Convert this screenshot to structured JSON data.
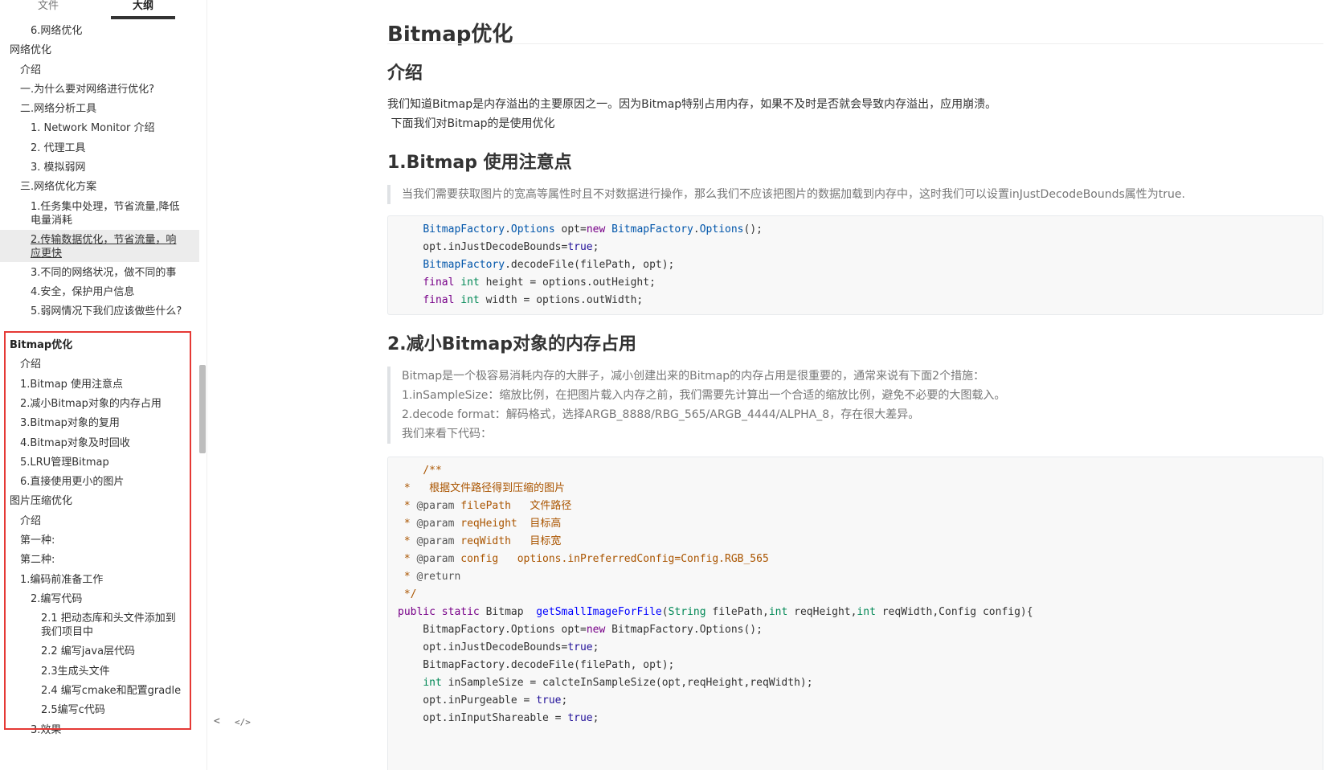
{
  "sidebar": {
    "tabs": [
      "文件",
      "大纲"
    ],
    "items": [
      {
        "label": "6.网络优化",
        "level": 3
      },
      {
        "label": "网络优化",
        "level": 1
      },
      {
        "label": "介绍",
        "level": 2
      },
      {
        "label": "一.为什么要对网络进行优化?",
        "level": 2
      },
      {
        "label": "二.网络分析工具",
        "level": 2
      },
      {
        "label": "1. Network Monitor 介绍",
        "level": 3
      },
      {
        "label": "2. 代理工具",
        "level": 3
      },
      {
        "label": "3. 模拟弱网",
        "level": 3
      },
      {
        "label": "三.网络优化方案",
        "level": 2
      },
      {
        "label": "1.任务集中处理，节省流量,降低电量消耗",
        "level": 3
      },
      {
        "label": "2.传输数据优化，节省流量，响应更快",
        "level": 3
      },
      {
        "label": "3.不同的网络状况，做不同的事",
        "level": 3
      },
      {
        "label": "4.安全，保护用户信息",
        "level": 3
      },
      {
        "label": "5.弱网情况下我们应该做些什么?",
        "level": 3
      },
      {
        "label": "Bitmap优化",
        "level": 1
      },
      {
        "label": "介绍",
        "level": 2
      },
      {
        "label": "1.Bitmap 使用注意点",
        "level": 2
      },
      {
        "label": "2.减小Bitmap对象的内存占用",
        "level": 2
      },
      {
        "label": "3.Bitmap对象的复用",
        "level": 2
      },
      {
        "label": "4.Bitmap对象及时回收",
        "level": 2
      },
      {
        "label": "5.LRU管理Bitmap",
        "level": 2
      },
      {
        "label": "6.直接使用更小的图片",
        "level": 2
      },
      {
        "label": "图片压缩优化",
        "level": 1
      },
      {
        "label": "介绍",
        "level": 2
      },
      {
        "label": "第一种:",
        "level": 2
      },
      {
        "label": "第二种:",
        "level": 2
      },
      {
        "label": "1.编码前准备工作",
        "level": 2
      },
      {
        "label": "2.编写代码",
        "level": 3
      },
      {
        "label": "2.1 把动态库和头文件添加到我们项目中",
        "level": 4
      },
      {
        "label": "2.2 编写java层代码",
        "level": 4
      },
      {
        "label": "2.3生成头文件",
        "level": 4
      },
      {
        "label": "2.4 编写cmake和配置gradle",
        "level": 4
      },
      {
        "label": "2.5编写c代码",
        "level": 4
      },
      {
        "label": "3.效果",
        "level": 3
      }
    ],
    "active_index": 10,
    "tools": [
      "<",
      "</>"
    ]
  },
  "main": {
    "title": "Bitmap优化",
    "intro_heading": "介绍",
    "intro_lines": [
      "我们知道Bitmap是内存溢出的主要原因之一。因为Bitmap特别占用内存，如果不及时是否就会导致内存溢出，应用崩溃。",
      " 下面我们对Bitmap的是使用优化"
    ],
    "section1_heading": "1.Bitmap 使用注意点",
    "section1_quote": "当我们需要获取图片的宽高等属性时且不对数据进行操作，那么我们不应该把图片的数据加载到内存中，这时我们可以设置inJustDecodeBounds属性为true.",
    "section2_heading": "2.减小Bitmap对象的内存占用",
    "section2_quote": [
      "Bitmap是一个极容易消耗内存的大胖子，减小创建出来的Bitmap的内存占用是很重要的，通常来说有下面2个措施：",
      "1.inSampleSize：缩放比例，在把图片载入内存之前，我们需要先计算出一个合适的缩放比例，避免不必要的大图载入。",
      "2.decode format：解码格式，选择ARGB_8888/RBG_565/ARGB_4444/ALPHA_8，存在很大差异。",
      "我们来看下代码："
    ]
  },
  "code1": [
    "    BitmapFactory.Options opt=new BitmapFactory.Options();",
    "    opt.inJustDecodeBounds=true;",
    "    BitmapFactory.decodeFile(filePath, opt);",
    "    final int height = options.outHeight;",
    "    final int width = options.outWidth;"
  ],
  "code2": [
    "    /**",
    " *   根据文件路径得到压缩的图片",
    " * @param filePath   文件路径",
    " * @param reqHeight  目标高",
    " * @param reqWidth   目标宽",
    " * @param config   options.inPreferredConfig=Config.RGB_565",
    " * @return",
    " */",
    "public static Bitmap  getSmallImageForFile(String filePath,int reqHeight,int reqWidth,Config config){",
    "    BitmapFactory.Options opt=new BitmapFactory.Options();",
    "    opt.inJustDecodeBounds=true;",
    "    BitmapFactory.decodeFile(filePath, opt);",
    "    int inSampleSize = calcteInSampleSize(opt,reqHeight,reqWidth);",
    "    opt.inPurgeable = true;",
    "    opt.inInputShareable = true;"
  ],
  "colors": {
    "highlight_box": "#e53935",
    "keyword": "#770088",
    "type": "#008855",
    "class": "#0055aa",
    "comment": "#aa5500",
    "function": "#0000ff"
  }
}
